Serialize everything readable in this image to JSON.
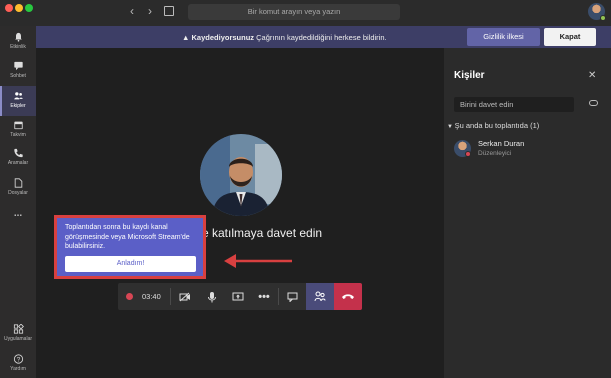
{
  "topbar": {
    "search_placeholder": "Bir komut arayın veya yazın",
    "back_icon": "‹",
    "forward_icon": "›"
  },
  "rail": {
    "items": [
      {
        "label": "Etkinlik",
        "icon": "bell-icon"
      },
      {
        "label": "Sohbet",
        "icon": "chat-icon"
      },
      {
        "label": "Ekipler",
        "icon": "teams-icon",
        "active": true
      },
      {
        "label": "Takvim",
        "icon": "calendar-icon"
      },
      {
        "label": "Aramalar",
        "icon": "phone-icon"
      },
      {
        "label": "Dosyalar",
        "icon": "files-icon"
      },
      {
        "label": "...",
        "icon": "more-icon"
      },
      {
        "label": "Uygulamalar",
        "icon": "apps-icon"
      },
      {
        "label": "Yardım",
        "icon": "help-icon"
      }
    ]
  },
  "banner": {
    "bold": "Kaydediyorsunuz",
    "text": " Çağrının kaydedildiğini herkese bildirin.",
    "policy_button": "Gizlilik ilkesi",
    "close_button": "Kapat"
  },
  "stage": {
    "invite_text": "e katılmaya davet edin"
  },
  "tooltip": {
    "text": "Toplantıdan sonra bu kaydı kanal görüşmesinde veya Microsoft Stream'de bulabilirsiniz.",
    "button": "Anladım!"
  },
  "controls": {
    "timer": "03:40"
  },
  "panel": {
    "title": "Kişiler",
    "close": "✕",
    "invite_placeholder": "Birini davet edin",
    "section": "Şu anda bu toplantıda (1)",
    "participants": [
      {
        "name": "Serkan Duran",
        "role": "Düzenleyici"
      }
    ]
  },
  "colors": {
    "accent": "#6264a7",
    "banner_bg": "#3d3e66",
    "hangup": "#c4314b",
    "annotation_red": "#d84040"
  }
}
